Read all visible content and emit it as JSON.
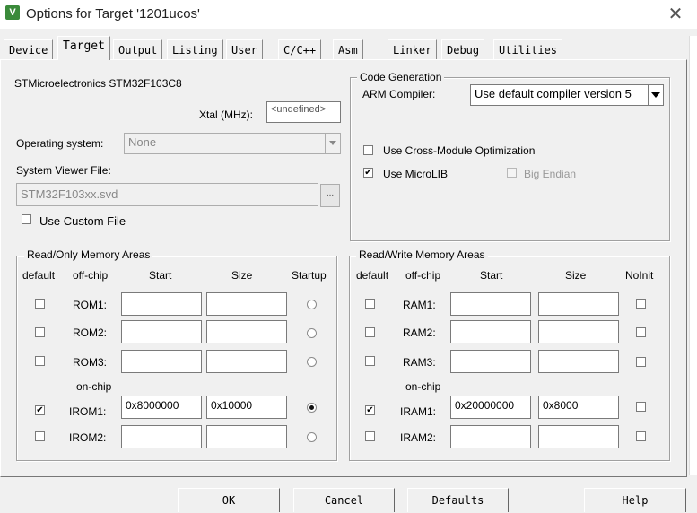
{
  "window": {
    "title": "Options for Target '1201ucos'",
    "icon_text": "V",
    "close_glyph": "✕"
  },
  "tabs": [
    "Device",
    "Target",
    "Output",
    "Listing",
    "User",
    "C/C++",
    "Asm",
    "Linker",
    "Debug",
    "Utilities"
  ],
  "active_tab": "Target",
  "device": {
    "name": "STMicroelectronics STM32F103C8",
    "xtal_label": "Xtal (MHz):",
    "xtal_value": "<undefined>",
    "os_label": "Operating system:",
    "os_value": "None",
    "svd_label": "System Viewer File:",
    "svd_value": "STM32F103xx.svd",
    "browse_label": "...",
    "custom_file_label": "Use Custom File",
    "custom_file_checked": false
  },
  "code_generation": {
    "title": "Code Generation",
    "compiler_label": "ARM Compiler:",
    "compiler_value": "Use default compiler version 5",
    "cross_module_label": "Use Cross-Module Optimization",
    "cross_module_checked": false,
    "microlib_label": "Use MicroLIB",
    "microlib_checked": true,
    "big_endian_label": "Big Endian",
    "big_endian_checked": false
  },
  "ro_memory": {
    "title": "Read/Only Memory Areas",
    "headers": [
      "default",
      "off-chip",
      "Start",
      "Size",
      "Startup"
    ],
    "onchip_label": "on-chip",
    "rows": [
      {
        "label": "ROM1:",
        "start": "",
        "size": "",
        "default": false,
        "startup": false
      },
      {
        "label": "ROM2:",
        "start": "",
        "size": "",
        "default": false,
        "startup": false
      },
      {
        "label": "ROM3:",
        "start": "",
        "size": "",
        "default": false,
        "startup": false
      },
      {
        "label": "IROM1:",
        "start": "0x8000000",
        "size": "0x10000",
        "default": true,
        "startup": true
      },
      {
        "label": "IROM2:",
        "start": "",
        "size": "",
        "default": false,
        "startup": false
      }
    ]
  },
  "rw_memory": {
    "title": "Read/Write Memory Areas",
    "headers": [
      "default",
      "off-chip",
      "Start",
      "Size",
      "NoInit"
    ],
    "onchip_label": "on-chip",
    "rows": [
      {
        "label": "RAM1:",
        "start": "",
        "size": "",
        "default": false,
        "noinit": false
      },
      {
        "label": "RAM2:",
        "start": "",
        "size": "",
        "default": false,
        "noinit": false
      },
      {
        "label": "RAM3:",
        "start": "",
        "size": "",
        "default": false,
        "noinit": false
      },
      {
        "label": "IRAM1:",
        "start": "0x20000000",
        "size": "0x8000",
        "default": true,
        "noinit": false
      },
      {
        "label": "IRAM2:",
        "start": "",
        "size": "",
        "default": false,
        "noinit": false
      }
    ]
  },
  "buttons": {
    "ok": "OK",
    "cancel": "Cancel",
    "defaults": "Defaults",
    "help": "Help"
  },
  "colors": {
    "dialog_bg": "#f0f0f0",
    "app_icon": "#3a8a3a"
  }
}
